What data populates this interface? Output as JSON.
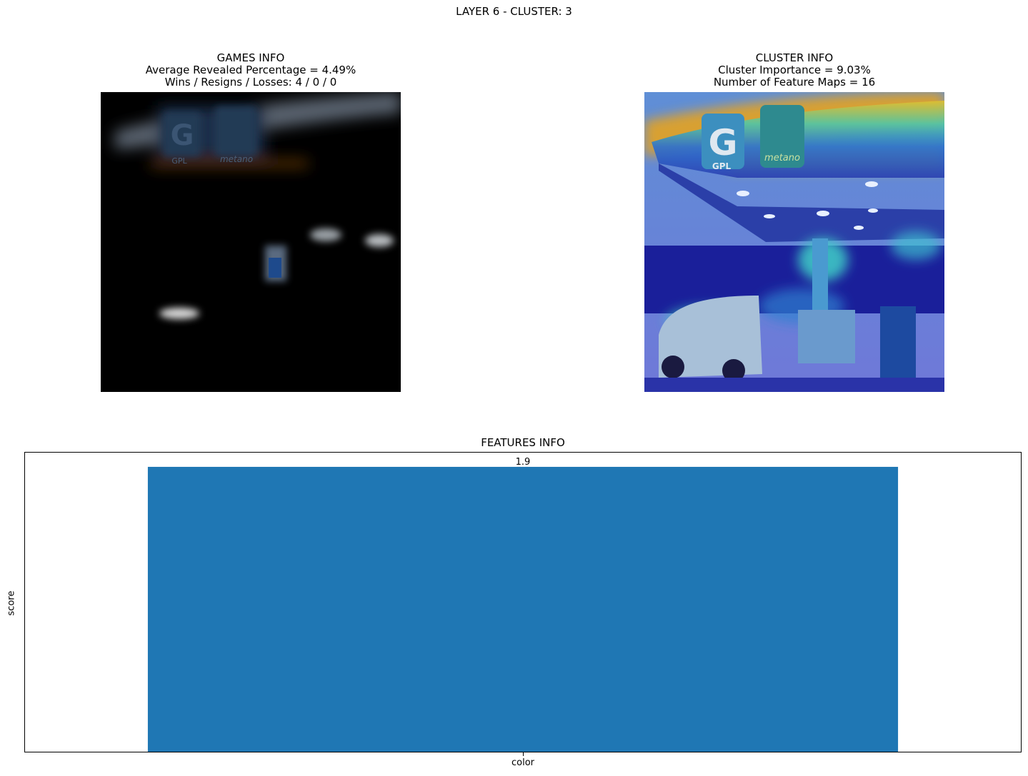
{
  "figure": {
    "suptitle": "LAYER 6 - CLUSTER: 3"
  },
  "games_info": {
    "title": "GAMES INFO",
    "line1": "Average Revealed Percentage = 4.49%",
    "line2": "Wins / Resigns / Losses: 4 / 0 / 0",
    "image_sign_g": "G",
    "image_sign_gpl": "GPL",
    "image_sign_metano": "metano"
  },
  "cluster_info": {
    "title": "CLUSTER INFO",
    "line1": "Cluster Importance = 9.03%",
    "line2": "Number of Feature Maps = 16",
    "image_sign_g": "G",
    "image_sign_gpl": "GPL",
    "image_sign_metano": "metano"
  },
  "chart_data": {
    "type": "bar",
    "title": "FEATURES INFO",
    "categories": [
      "color"
    ],
    "values": [
      1.9
    ],
    "data_labels": [
      "1.9"
    ],
    "xlabel": "",
    "ylabel": "score",
    "ylim": [
      0,
      1.995
    ],
    "yticks_visible": false,
    "grid": false,
    "bar_color": "#1f77b4"
  }
}
